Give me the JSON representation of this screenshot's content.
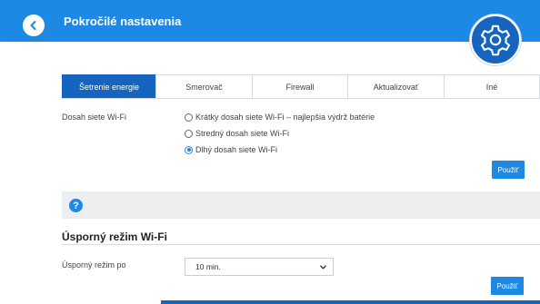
{
  "header": {
    "title": "Pokročilé nastavenia",
    "back_icon": "chevron-left-icon",
    "badge_icon": "gear-icon"
  },
  "tabs": [
    {
      "label": "Šetrenie energie",
      "active": true
    },
    {
      "label": "Smerovač",
      "active": false
    },
    {
      "label": "Firewall",
      "active": false
    },
    {
      "label": "Aktualizovať",
      "active": false
    },
    {
      "label": "Iné",
      "active": false
    }
  ],
  "wifi_range": {
    "label": "Dosah siete Wi-Fi",
    "options": [
      {
        "label": "Krátky dosah siete Wi-Fi – najlepšia výdrž batérie",
        "selected": false
      },
      {
        "label": "Stredný dosah siete Wi-Fi",
        "selected": false
      },
      {
        "label": "Dlhý dosah siete Wi-Fi",
        "selected": true
      }
    ],
    "apply_label": "Použiť"
  },
  "help": {
    "icon": "help-icon",
    "glyph": "?"
  },
  "power_save": {
    "title": "Úsporný režim Wi-Fi",
    "label": "Úsporný režim po",
    "selected_value": "10 min.",
    "apply_label": "Použiť"
  },
  "colors": {
    "accent": "#1e88e5",
    "accent_dark": "#1565c0",
    "help_bar": "#eceef0"
  }
}
